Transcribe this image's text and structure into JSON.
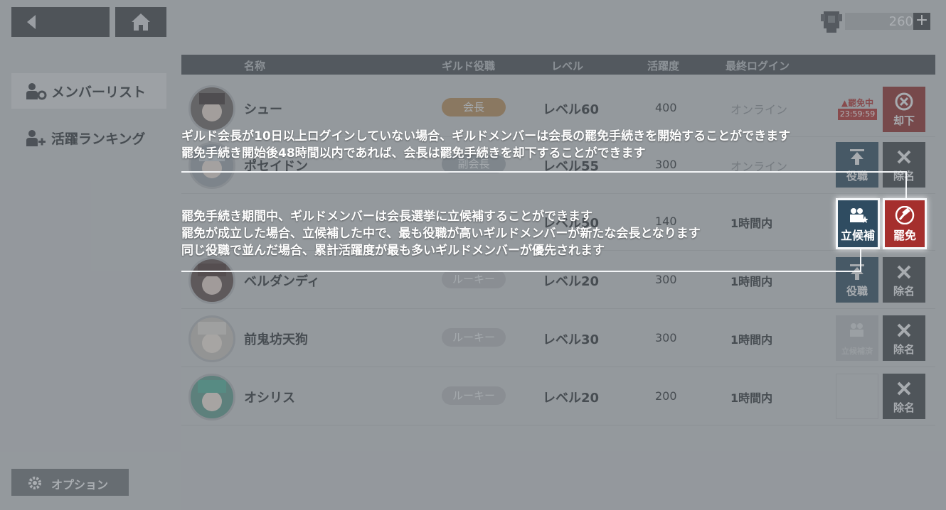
{
  "currency": {
    "value": "260",
    "plus_label": "+",
    "icon": "trophy-cup-icon"
  },
  "sidebar": {
    "items": [
      {
        "label": "メンバーリスト",
        "icon": "member-settings-icon",
        "active": true
      },
      {
        "label": "活躍ランキング",
        "icon": "member-add-icon",
        "active": false
      }
    ],
    "option_label": "オプション"
  },
  "table": {
    "headers": {
      "name": "名称",
      "role": "ギルド役職",
      "level": "レベル",
      "activity": "活躍度",
      "last_login": "最終ログイン"
    },
    "rows": [
      {
        "name": "シュー",
        "role": "会長",
        "level": "レベル60",
        "activity": "400",
        "last_login": "オンライン"
      },
      {
        "name": "ポセイドン",
        "role": "副会長",
        "level": "レベル55",
        "activity": "300",
        "last_login": "オンライン"
      },
      {
        "name": "",
        "role": "",
        "level": "レベル50",
        "activity": "140",
        "last_login": "1時間内"
      },
      {
        "name": "ベルダンディ",
        "role": "ルーキー",
        "level": "レベル20",
        "activity": "300",
        "last_login": "1時間内"
      },
      {
        "name": "前鬼坊天狗",
        "role": "ルーキー",
        "level": "レベル30",
        "activity": "300",
        "last_login": "1時間内"
      },
      {
        "name": "オシリス",
        "role": "ルーキー",
        "level": "レベル20",
        "activity": "200",
        "last_login": "1時間内"
      }
    ]
  },
  "actions": {
    "reject": "却下",
    "promote": "役職",
    "remove": "除名",
    "candidate": "立候補",
    "candidate_faded": "立候補済",
    "dismiss": "罷免",
    "dismiss_badge_title": "罷免中",
    "dismiss_timer": "23:59:59"
  },
  "tutorial": {
    "top_lines": [
      "ギルド会長が10日以上ログインしていない場合、ギルドメンバーは会長の罷免手続きを開始することができます",
      "罷免手続き開始後48時間以内であれば、会長は罷免手続きを却下することができます"
    ],
    "bottom_lines": [
      "罷免手続き期間中、ギルドメンバーは会長選挙に立候補することができます",
      "罷免が成立した場合、立候補した中で、最も役職が高いギルドメンバーが新たな会長となります",
      "同じ役職で並んだ場合、累計活躍度が最も多いギルドメンバーが優先されます"
    ]
  },
  "colors": {
    "leader_badge": "#b48a57",
    "red_button": "#8e2c2b",
    "blue_button": "#2f4c61"
  }
}
